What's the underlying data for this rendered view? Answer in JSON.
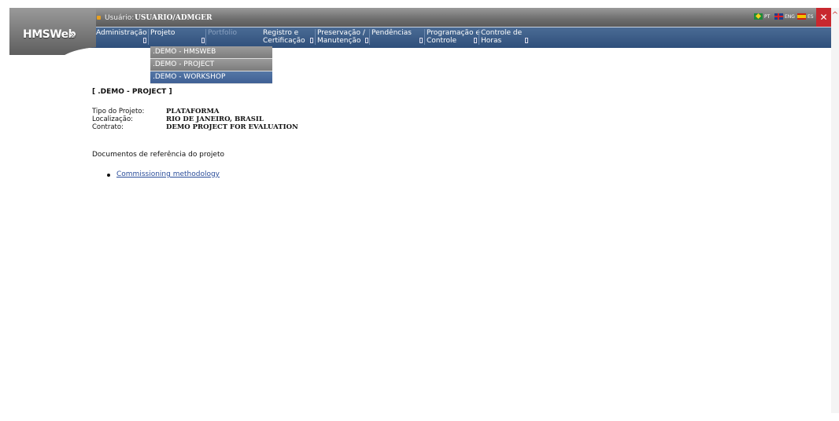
{
  "header": {
    "logo_text": "HMSWeb",
    "logo_chevrons": "»",
    "user_label": "Usuário:",
    "user_value": "USUARIO/ADMGER",
    "languages": [
      {
        "code": "PT",
        "flag": "brazil-flag"
      },
      {
        "code": "ENG",
        "flag": "uk-flag"
      },
      {
        "code": "ES",
        "flag": "spain-flag"
      }
    ],
    "close_label": "✕"
  },
  "menu": {
    "items": [
      {
        "line1": "Administração",
        "line2": ""
      },
      {
        "line1": "Projeto",
        "line2": ""
      },
      {
        "line1": "Portfolio",
        "line2": "",
        "disabled": true
      },
      {
        "line1": "Registro e",
        "line2": "Certificação"
      },
      {
        "line1": "Preservação /",
        "line2": "Manutenção"
      },
      {
        "line1": "Pendências",
        "line2": ""
      },
      {
        "line1": "Programação e",
        "line2": "Controle"
      },
      {
        "line1": "Controle de",
        "line2": "Horas"
      }
    ]
  },
  "dropdown": {
    "items": [
      ".DEMO - HMSWEB",
      ".DEMO - PROJECT",
      ".DEMO - WORKSHOP"
    ],
    "highlighted_index": 2
  },
  "project": {
    "title": "[ .DEMO - PROJECT ]",
    "fields": [
      {
        "label": "Tipo do Projeto:",
        "value": "PLATAFORMA"
      },
      {
        "label": "Localização:",
        "value": "RIO DE JANEIRO, BRASIL"
      },
      {
        "label": "Contrato:",
        "value": "DEMO PROJECT FOR EVALUATION"
      }
    ],
    "docs_heading": "Documentos de referência do projeto",
    "documents": [
      "Commissioning methodology"
    ]
  },
  "colors": {
    "menubar": "#2f4f7b",
    "topbar": "#6d6d6d",
    "dropdown_active": "#4a6b9d",
    "close": "#c8282f",
    "link": "#2a4d9a"
  }
}
